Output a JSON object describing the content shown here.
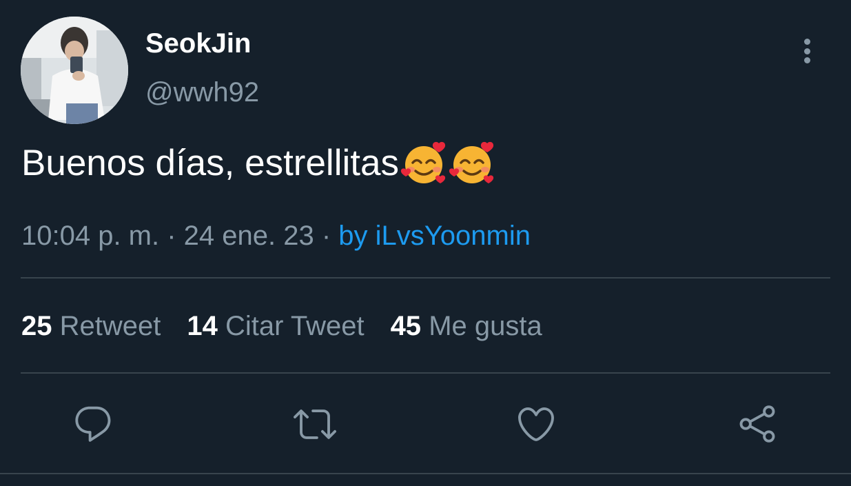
{
  "author": {
    "display_name": "SeokJin",
    "handle": "@wwh92"
  },
  "tweet": {
    "text": "Buenos días, estrellitas",
    "emojis": [
      "smiling-face-with-hearts",
      "smiling-face-with-hearts"
    ],
    "timestamp": "10:04 p. m. · 24 ene. 23 · ",
    "via": "by iLvsYoonmin"
  },
  "stats": [
    {
      "count": "25",
      "label": "Retweet"
    },
    {
      "count": "14",
      "label": "Citar Tweet"
    },
    {
      "count": "45",
      "label": "Me gusta"
    }
  ],
  "actions": [
    "reply-icon",
    "retweet-icon",
    "like-icon",
    "share-icon"
  ],
  "colors": {
    "background": "#15202b",
    "secondary_text": "#8899a6",
    "link": "#1d9bf0",
    "divider": "#38444d"
  }
}
